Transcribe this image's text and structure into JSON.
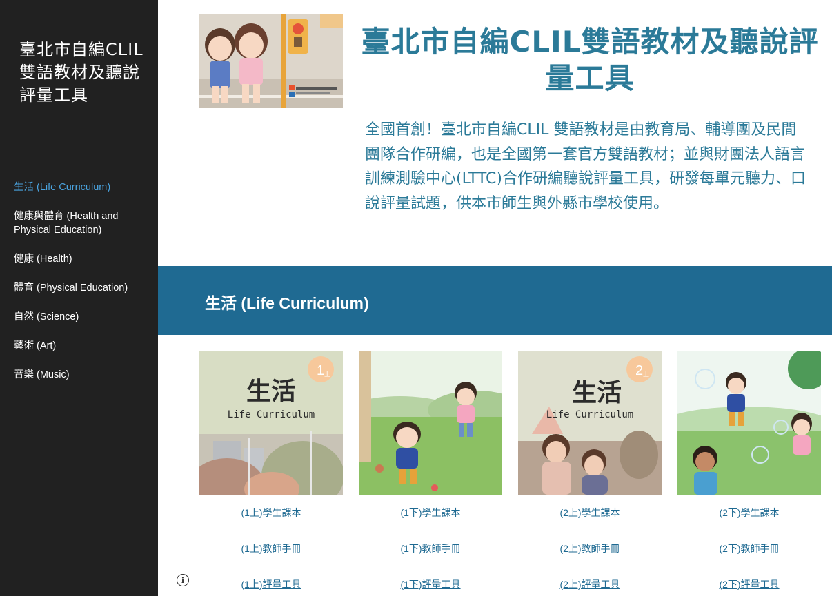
{
  "sidebar": {
    "site_title": "臺北市自編CLIL雙語教材及聽說評量工具",
    "nav": [
      {
        "label": "生活 (Life Curriculum)",
        "active": true
      },
      {
        "label": "健康與體育 (Health and Physical Education)",
        "active": false
      },
      {
        "label": "健康 (Health)",
        "active": false
      },
      {
        "label": "體育 (Physical Education)",
        "active": false
      },
      {
        "label": "自然 (Science)",
        "active": false
      },
      {
        "label": "藝術 (Art)",
        "active": false
      },
      {
        "label": "音樂 (Music)",
        "active": false
      }
    ]
  },
  "header": {
    "title": "臺北市自編CLIL雙語教材及聽說評量工具",
    "intro": "全國首創！臺北市自編CLIL 雙語教材是由教育局、輔導團及民間團隊合作研編，也是全國第一套官方雙語教材；並與財團法人語言訓練測驗中心(LTTC)合作研編聽說評量工具，研發每單元聽力、口說評量試題，供本市師生與外縣市學校使用。"
  },
  "section": {
    "title": "生活 (Life Curriculum)",
    "cards": [
      {
        "cover_title": "生活",
        "cover_subtitle": "Life Curriculum",
        "badge_number": "1",
        "badge_sub": "上",
        "links": [
          "(1上)學生課本",
          "(1上)教師手冊",
          "(1上)評量工具"
        ]
      },
      {
        "links": [
          "(1下)學生課本",
          "(1下)教師手冊",
          "(1下)評量工具"
        ]
      },
      {
        "cover_title": "生活",
        "cover_subtitle": "Life Curriculum",
        "badge_number": "2",
        "badge_sub": "上",
        "links": [
          "(2上)學生課本",
          "(2上)教師手冊",
          "(2上)評量工具"
        ]
      },
      {
        "links": [
          "(2下)學生課本",
          "(2下)教師手冊",
          "(2下)評量工具"
        ]
      }
    ]
  },
  "footer": {
    "info_icon": "info-icon"
  }
}
